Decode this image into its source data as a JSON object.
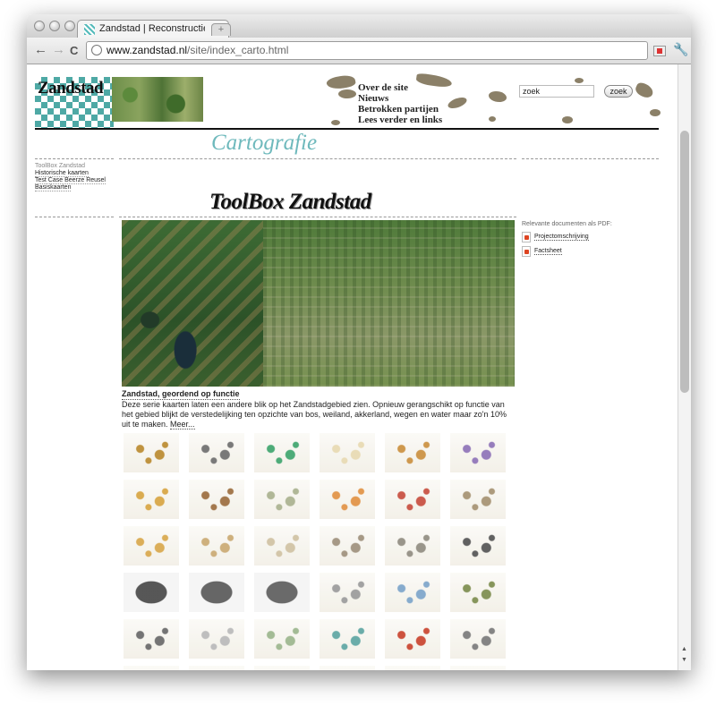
{
  "browser": {
    "tab_title": "Zandstad | Reconstructie van",
    "tab_close": "✕",
    "new_tab": "+",
    "url_host": "www.zandstad.nl",
    "url_path": "/site/index_carto.html",
    "back": "←",
    "forward": "→",
    "reload": "C",
    "star": "☆",
    "wrench": "🔧"
  },
  "site": {
    "logo_text": "Zandstad",
    "nav": [
      "Over de site",
      "Nieuws",
      "Betrokken partijen",
      "Lees verder en links"
    ],
    "search_value": "zoek",
    "search_button": "zoek",
    "section_title": "Cartografie"
  },
  "left_nav": {
    "current": "ToolBox Zandstad",
    "links": [
      "Historische kaarten",
      "Test Case Beerze Reusel",
      "Basiskaarten"
    ]
  },
  "main": {
    "title": "ToolBox Zandstad",
    "caption_title": "Zandstad, geordend op functie",
    "caption_text": "Deze serie kaarten laten een andere blik op het Zandstadgebied zien. Opnieuw gerangschikt op functie van het gebied blijkt de verstedelijking ten opzichte van bos, weiland, akkerland, wegen en water maar zo'n 10% uit te maken.",
    "more_link": "Meer..."
  },
  "sidebar": {
    "heading": "Relevante documenten als PDF:",
    "docs": [
      "Projectomschrijving",
      "Factsheet"
    ]
  },
  "thumbnails": {
    "count": 36,
    "colors": [
      "#b9882b",
      "#6b6b6b",
      "#3aa36a",
      "#e7d9b0",
      "#c98d3a",
      "#8b6fb5",
      "#d6a23e",
      "#9a6a3a",
      "#a8b08c",
      "#e09040",
      "#c64a3a",
      "#a4906e",
      "#d8a648",
      "#c9a870",
      "#cfc0a0",
      "#9d8f7a",
      "#8e8a7e",
      "#505050",
      "#444444",
      "#555555",
      "#5a5a5a",
      "#999999",
      "#7aa3c8",
      "#7a8a4a",
      "#666666",
      "#b8b8b8",
      "#9ab48a",
      "#5aa4a0",
      "#c8402a",
      "#777777",
      "#222222",
      "#bbbbbb",
      "#b09a6a",
      "#8a7ab0",
      "#888888",
      "#aaaaaa"
    ]
  },
  "colors": {
    "accent_teal": "#6eb9bc",
    "logo_teal": "#2f9a96",
    "blob": "#8b8068"
  }
}
